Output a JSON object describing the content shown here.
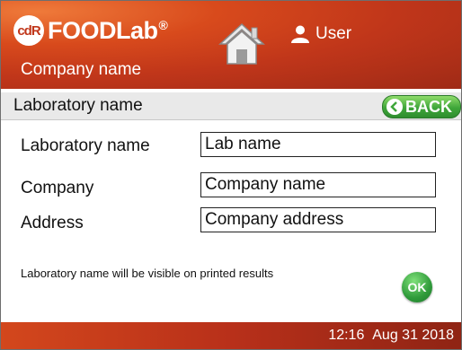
{
  "header": {
    "brand_badge": "cdR",
    "brand_name": "FOODLab",
    "brand_registered": "®",
    "company_name": "Company name",
    "home_icon": "home-icon",
    "user_icon": "user-icon",
    "user_label": "User"
  },
  "subbar": {
    "title": "Laboratory name",
    "back_label": "BACK"
  },
  "form": {
    "fields": [
      {
        "label": "Laboratory name",
        "value": "Lab name"
      },
      {
        "label": "Company",
        "value": "Company name"
      },
      {
        "label": "Address",
        "value": "Company address"
      }
    ],
    "hint": "Laboratory name will be visible on printed results",
    "ok_label": "OK"
  },
  "footer": {
    "time": "12:16",
    "date": "Aug 31 2018"
  },
  "colors": {
    "header": "#c0361a",
    "accent_green": "#3fa63a",
    "subbar": "#e9e9e9"
  }
}
